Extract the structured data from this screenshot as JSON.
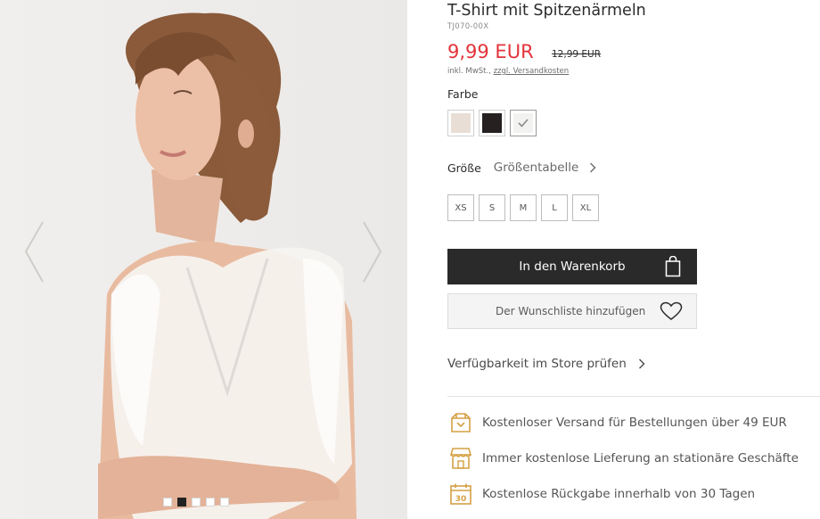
{
  "gallery": {
    "prev_icon": "chevron-left-icon",
    "next_icon": "chevron-right-icon",
    "dots": [
      {
        "active": false
      },
      {
        "active": true
      },
      {
        "active": false
      },
      {
        "active": false
      },
      {
        "active": false
      }
    ]
  },
  "product": {
    "title": "T-Shirt mit Spitzenärmeln",
    "sku": "TJ070-00X",
    "price": "9,99 EUR",
    "old_price": "12,99 EUR",
    "tax_note": "inkl. MwSt.,",
    "shipping_link": "zzgl. Versandkosten",
    "price_color": "#e2333a"
  },
  "colors": {
    "label": "Farbe",
    "swatches": [
      {
        "name": "beige",
        "color": "#e8ded6"
      },
      {
        "name": "black",
        "color": "#262021"
      },
      {
        "name": "white",
        "color": "#f2f3f1",
        "selected": true
      }
    ]
  },
  "sizes": {
    "label": "Größe",
    "size_chart_link": "Größentabelle",
    "options": [
      "XS",
      "S",
      "M",
      "L",
      "XL"
    ]
  },
  "actions": {
    "add_to_cart": "In den Warenkorb",
    "add_to_wishlist": "Der Wunschliste hinzufügen",
    "check_store": "Verfügbarkeit im Store prüfen"
  },
  "benefits": [
    {
      "icon": "delivery-truck-icon",
      "text": "Kostenloser Versand für Bestellungen über 49 EUR"
    },
    {
      "icon": "store-icon",
      "text": "Immer kostenlose Lieferung an stationäre Geschäfte"
    },
    {
      "icon": "calendar-30-icon",
      "text": "Kostenlose Rückgabe innerhalb von 30 Tagen"
    }
  ],
  "accent_color": "#d4a043"
}
